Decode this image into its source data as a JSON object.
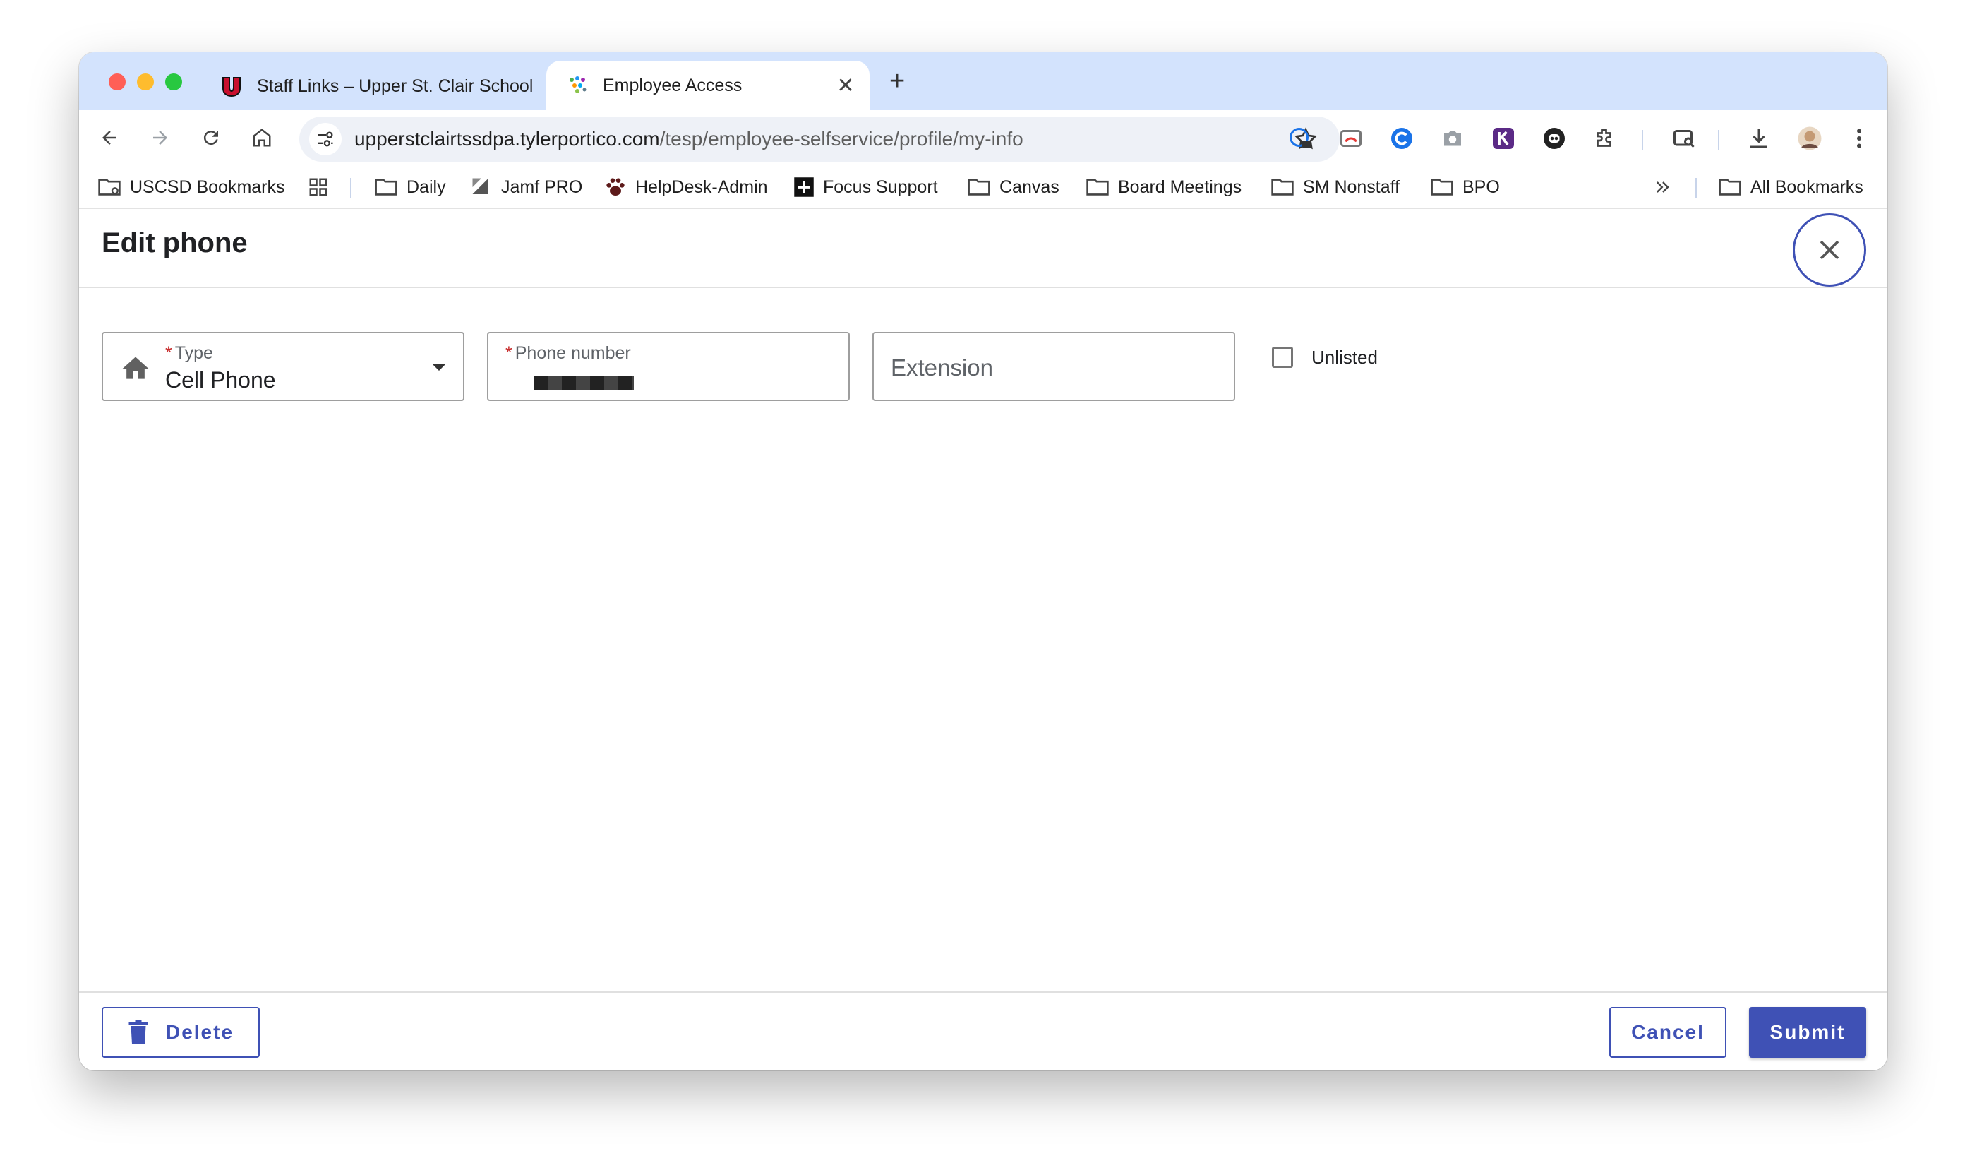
{
  "browser": {
    "tabs": [
      {
        "title": "Staff Links – Upper St. Clair School",
        "active": false,
        "icon": "school-u-logo-icon"
      },
      {
        "title": "Employee Access",
        "active": true,
        "icon": "tyler-logo-icon"
      }
    ],
    "new_tab_label": "+",
    "url_host": "upperstclairtssdpa.tylerportico.com",
    "url_path": "/tesp/employee-selfservice/profile/my-info",
    "bookmarks": [
      {
        "label": "USCSD Bookmarks",
        "icon": "managed-folder-icon"
      },
      {
        "label": "",
        "icon": "apps-grid-icon"
      },
      {
        "label": "Daily",
        "icon": "folder-icon"
      },
      {
        "label": "Jamf PRO",
        "icon": "jamf-icon"
      },
      {
        "label": "HelpDesk-Admin",
        "icon": "paw-icon"
      },
      {
        "label": "Focus Support",
        "icon": "focus-plus-icon"
      },
      {
        "label": "Canvas",
        "icon": "folder-icon"
      },
      {
        "label": "Board Meetings",
        "icon": "folder-icon"
      },
      {
        "label": "SM Nonstaff",
        "icon": "folder-icon"
      },
      {
        "label": "BPO",
        "icon": "folder-icon"
      }
    ],
    "all_bookmarks_label": "All Bookmarks"
  },
  "dialog": {
    "title": "Edit phone",
    "type_field": {
      "label": "Type",
      "value": "Cell Phone"
    },
    "phone_field": {
      "label": "Phone number"
    },
    "extension_field": {
      "placeholder": "Extension"
    },
    "unlisted": {
      "label": "Unlisted",
      "checked": false
    },
    "delete_label": "Delete",
    "cancel_label": "Cancel",
    "submit_label": "Submit"
  },
  "colors": {
    "accent": "#3f51b5",
    "tabstrip": "#d3e3fd",
    "required": "#c62828"
  }
}
